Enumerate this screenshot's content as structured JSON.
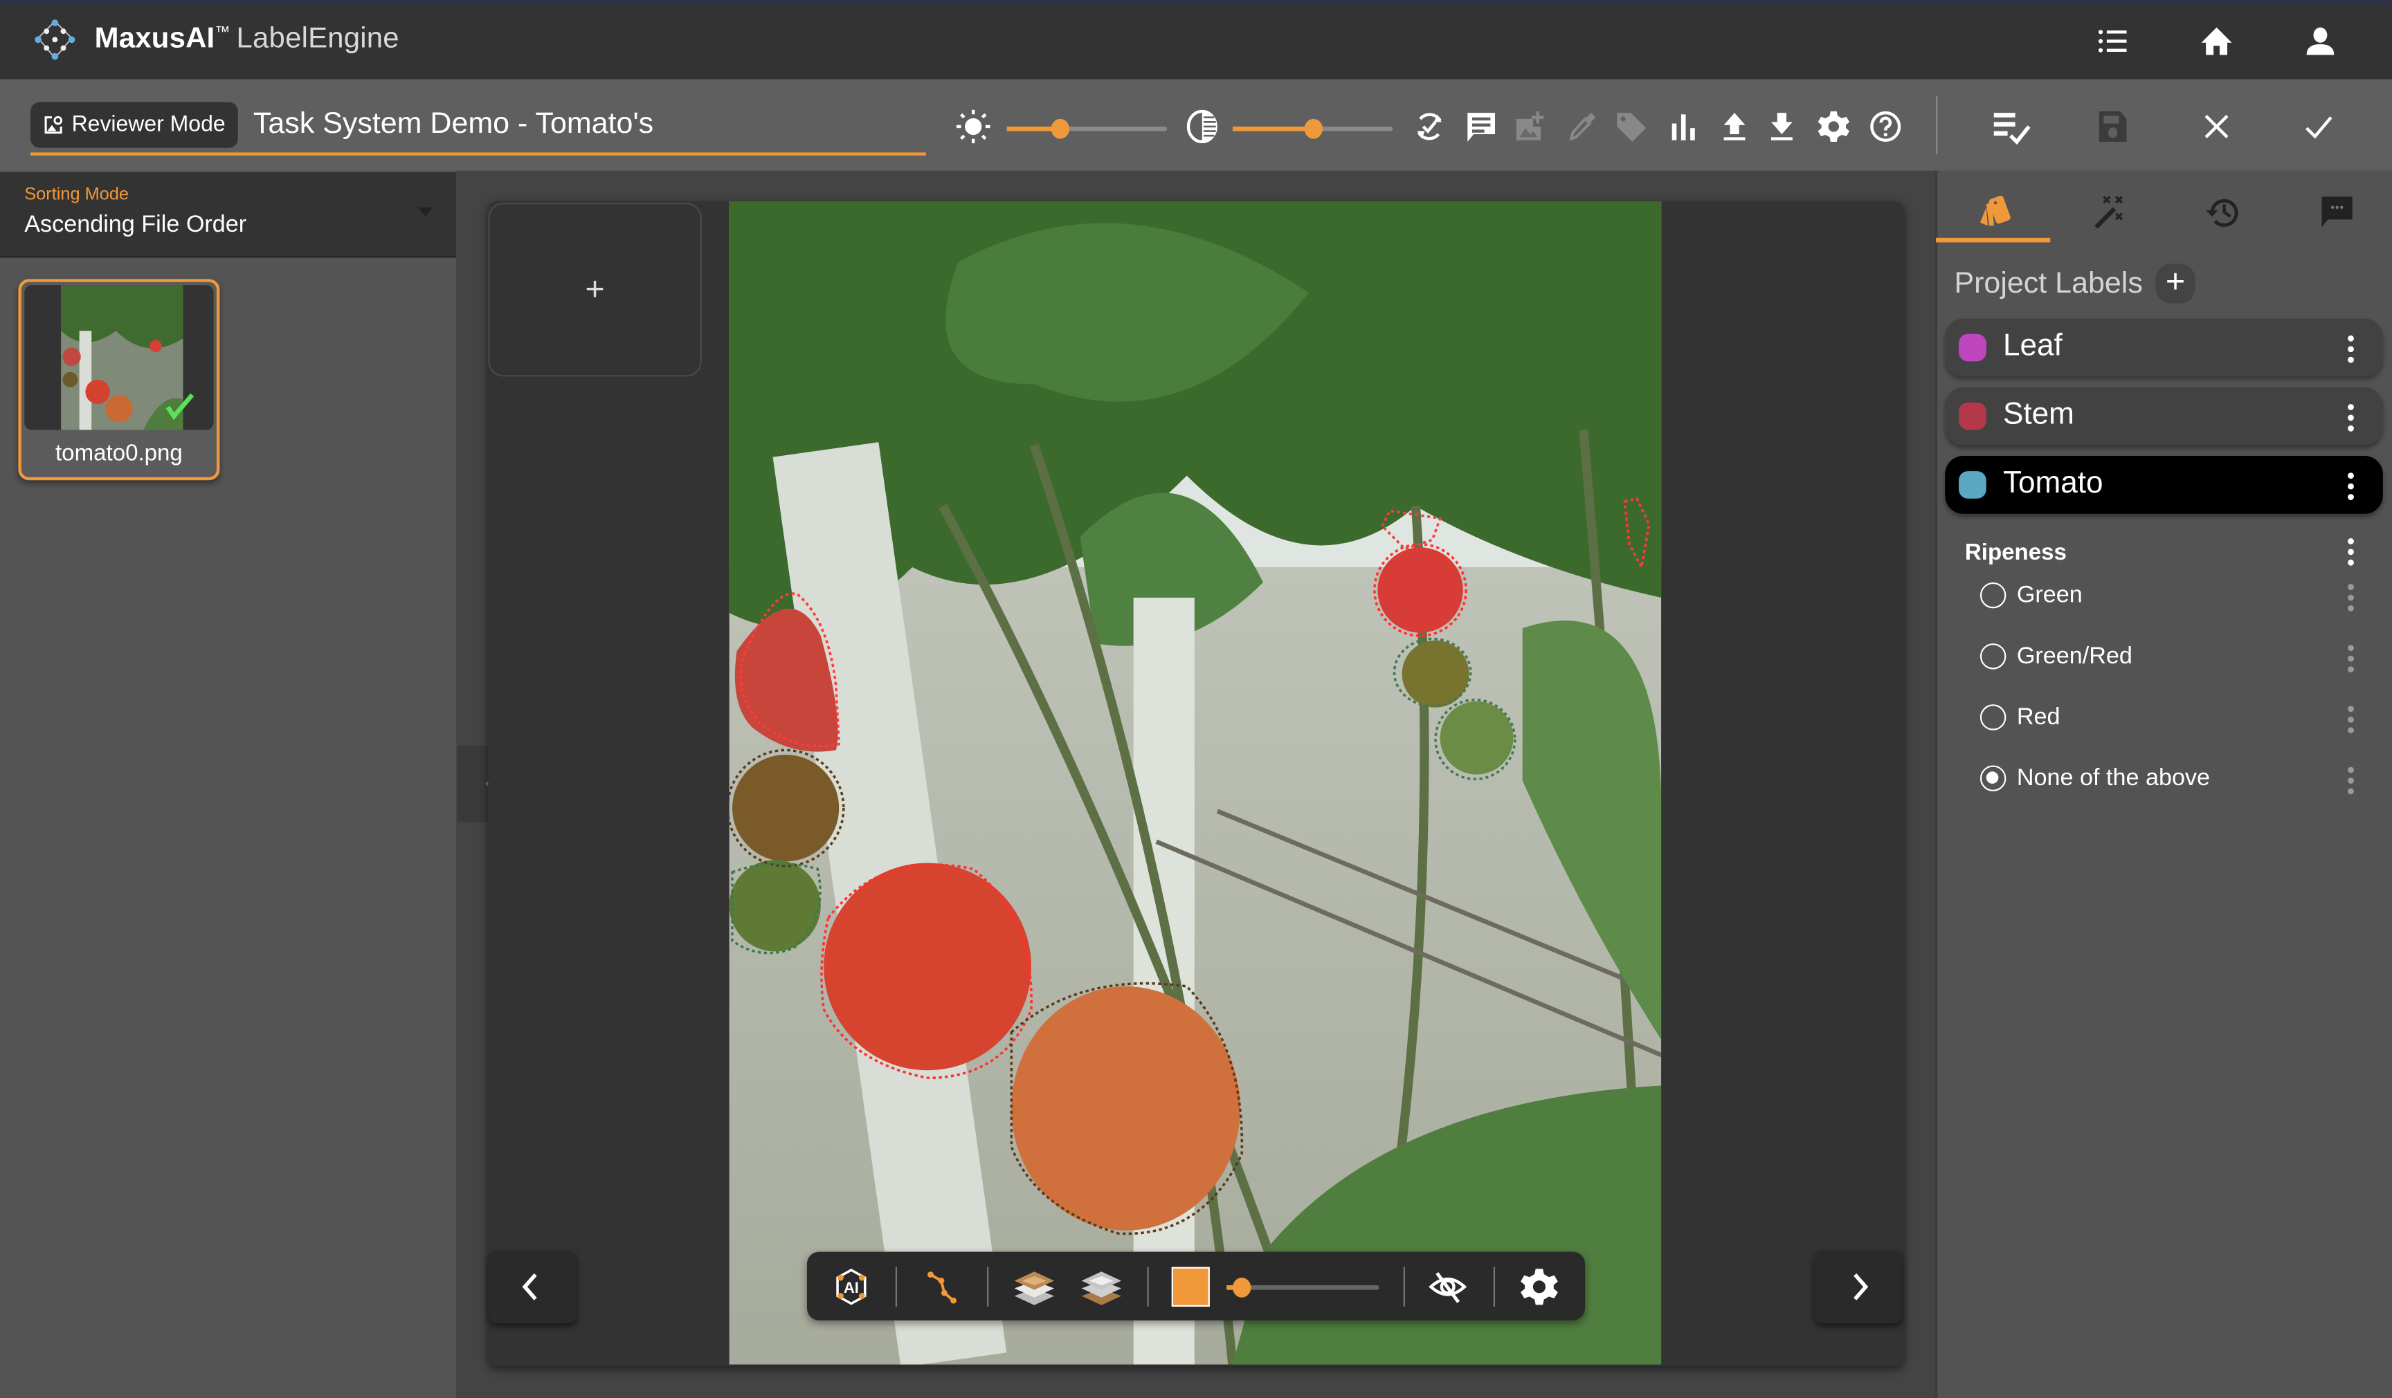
{
  "app": {
    "brand_name": "MaxusAI",
    "brand_tm": "™",
    "product_name": "LabelEngine",
    "top_icons": [
      "task-list-icon",
      "home-icon",
      "account-icon"
    ]
  },
  "toolbar": {
    "mode_label": "Reviewer Mode",
    "task_title": "Task System Demo - Tomato's",
    "brightness": 0.33,
    "contrast": 0.5,
    "icons": [
      "sync-check-icon",
      "comment-icon",
      "add-image-icon",
      "eyedropper-icon",
      "tag-icon",
      "bar-chart-icon",
      "upload-icon",
      "download-icon",
      "settings-icon",
      "help-icon"
    ],
    "disabled_icons": [
      "add-image-icon",
      "eyedropper-icon",
      "tag-icon"
    ],
    "right_actions": [
      "review-list-icon",
      "save-icon",
      "reject-icon",
      "approve-icon"
    ]
  },
  "sidebar": {
    "sort_label": "Sorting Mode",
    "sort_value": "Ascending File Order",
    "files": [
      {
        "name": "tomato0.png",
        "status": "complete",
        "selected": true
      }
    ]
  },
  "canvas": {
    "add_tile_symbol": "+",
    "annotation_opacity": 0.1,
    "fill_color": "#f0993a",
    "bottom_tools": [
      "ai-assist-icon",
      "polyline-tool-icon",
      "layer-up-icon",
      "layer-down-icon",
      "fill-color-swatch",
      "opacity-slider",
      "hide-annotations-icon",
      "canvas-settings-icon"
    ]
  },
  "right_panel": {
    "tabs": [
      "labels-tab",
      "magic-wand-tab",
      "history-tab",
      "comments-tab"
    ],
    "active_tab": 0,
    "project_labels_title": "Project Labels",
    "add_symbol": "+",
    "labels": [
      {
        "name": "Leaf",
        "color": "#c046c0",
        "selected": false
      },
      {
        "name": "Stem",
        "color": "#b5384a",
        "selected": false
      },
      {
        "name": "Tomato",
        "color": "#5aa8c4",
        "selected": true
      }
    ],
    "attribute": {
      "title": "Ripeness",
      "options": [
        {
          "label": "Green",
          "checked": false
        },
        {
          "label": "Green/Red",
          "checked": false
        },
        {
          "label": "Red",
          "checked": false
        },
        {
          "label": "None of the above",
          "checked": true
        }
      ]
    }
  }
}
